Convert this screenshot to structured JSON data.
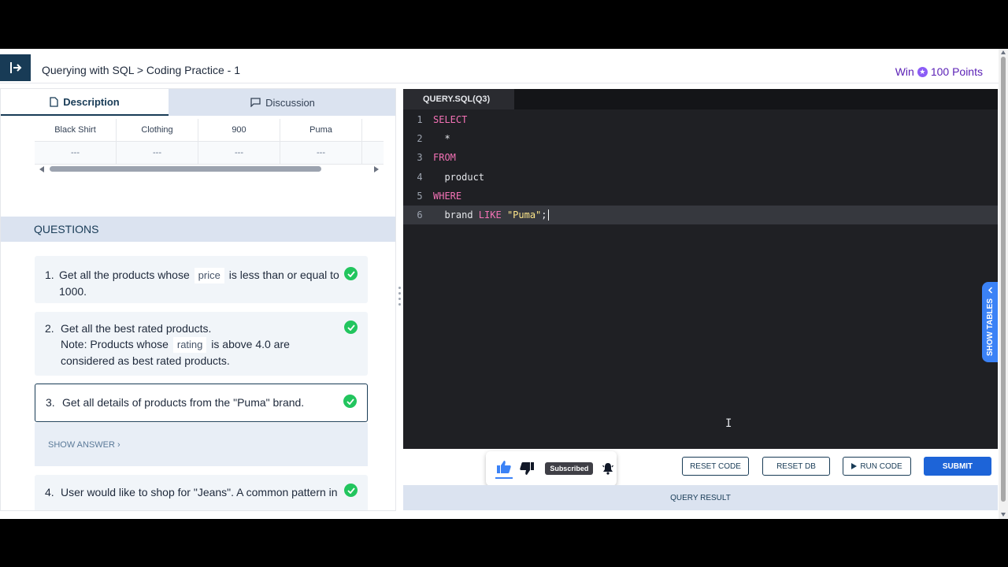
{
  "header": {
    "breadcrumb": "Querying with SQL > Coding Practice - 1",
    "win_prefix": "Win",
    "points": "100 Points"
  },
  "left_tabs": {
    "description": "Description",
    "discussion": "Discussion"
  },
  "product_table": {
    "rows": [
      [
        "Black Shirt",
        "Clothing",
        "900",
        "Puma"
      ],
      [
        "---",
        "---",
        "---",
        "---"
      ]
    ]
  },
  "questions": {
    "heading": "QUESTIONS",
    "q1": {
      "number": "1.",
      "text_before": "Get all the products whose",
      "code": "price",
      "text_after": "is less than or equal to 1000."
    },
    "q2": {
      "number": "2.",
      "line1": "Get all the best rated products.",
      "note_before": "Note: Products whose",
      "code": "rating",
      "note_after": "is above 4.0 are considered as best rated products."
    },
    "q3": {
      "number": "3.",
      "text": "Get all details of products from the \"Puma\" brand."
    },
    "show_answer": "SHOW ANSWER",
    "q4": {
      "number": "4.",
      "text": "User would like to shop for \"Jeans\". A common pattern in"
    }
  },
  "editor": {
    "tab_label": "QUERY.SQL(Q3)",
    "lines": [
      {
        "n": "1",
        "kw": "SELECT",
        "rest": ""
      },
      {
        "n": "2",
        "text": "  *"
      },
      {
        "n": "3",
        "kw": "FROM",
        "rest": ""
      },
      {
        "n": "4",
        "text": "  product"
      },
      {
        "n": "5",
        "kw": "WHERE",
        "rest": ""
      },
      {
        "n": "6",
        "pre": "  brand ",
        "kw": "LIKE",
        "str": "\"Puma\"",
        "post": ";"
      }
    ],
    "side_tab": "SHOW TABLES"
  },
  "reactions": {
    "subscribed": "Subscribed"
  },
  "actions": {
    "reset_code": "RESET CODE",
    "reset_db": "RESET DB",
    "run_code": "RUN CODE",
    "submit": "SUBMIT"
  },
  "result_bar": "QUERY RESULT",
  "icons": {
    "menu": "collapse-sidebar-icon",
    "star": "points-star-icon",
    "description": "document-icon",
    "discussion": "chat-icon",
    "check": "check-circle-icon",
    "like": "thumbs-up-icon",
    "dislike": "thumbs-down-icon",
    "bell": "bell-icon",
    "play": "play-icon"
  },
  "colors": {
    "brand_dark": "#183b56",
    "accent_blue": "#1d64d8",
    "success": "#22c55e",
    "editor_bg": "#1f2024",
    "keyword": "#f472b6",
    "string": "#fde68a"
  }
}
